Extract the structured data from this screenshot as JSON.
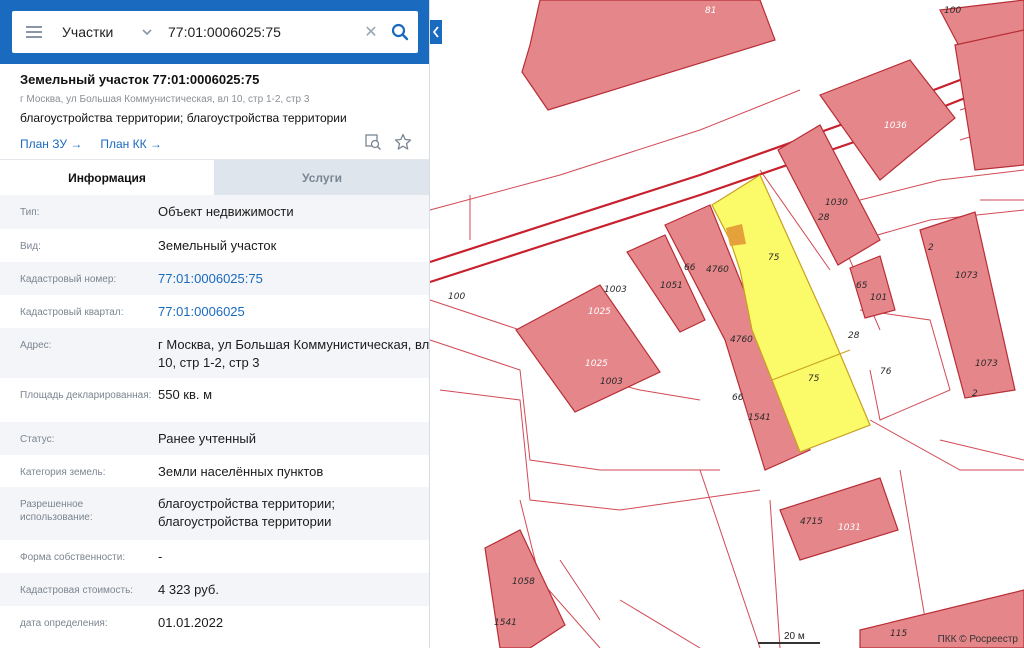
{
  "search": {
    "type_label": "Участки",
    "value": "77:01:0006025:75",
    "placeholder": ""
  },
  "object": {
    "title": "Земельный участок 77:01:0006025:75",
    "address": "г Москва, ул Большая Коммунистическая, вл 10, стр 1-2, стр 3",
    "use": "благоустройства территории; благоустройства территории",
    "links": [
      "План ЗУ →",
      "План КК →"
    ]
  },
  "tabs": [
    "Информация",
    "Услуги"
  ],
  "properties": [
    {
      "key": "Тип:",
      "value": "Объект недвижимости"
    },
    {
      "key": "Вид:",
      "value": "Земельный участок"
    },
    {
      "key": "Кадастровый номер:",
      "value": "77:01:0006025:75",
      "link": true
    },
    {
      "key": "Кадастровый квартал:",
      "value": "77:01:0006025",
      "link": true
    },
    {
      "key": "Адрес:",
      "value": "г Москва, ул Большая Коммунистическая, вл 10, стр 1-2, стр 3"
    },
    {
      "key": "Площадь декларированная:",
      "value": "550 кв. м"
    },
    {
      "key": "Статус:",
      "value": "Ранее учтенный"
    },
    {
      "key": "Категория земель:",
      "value": "Земли населённых пунктов"
    },
    {
      "key": "Разрешенное использование:",
      "value": "благоустройства территории; благоустройства территории"
    },
    {
      "key": "Форма собственности:",
      "value": "-"
    },
    {
      "key": "Кадастровая стоимость:",
      "value": "4 323 руб."
    },
    {
      "key": "дата определения:",
      "value": "01.01.2022"
    }
  ],
  "map": {
    "labels": {
      "l81": "81",
      "l100a": "100",
      "l1036": "1036",
      "l1030": "1030",
      "l28a": "28",
      "l2a": "2",
      "l1073a": "1073",
      "l1073b": "1073",
      "l2b": "2",
      "l75a": "75",
      "l75b": "75",
      "l76": "76",
      "l4760a": "4760",
      "l4760b": "4760",
      "l66a": "66",
      "l66b": "66",
      "l1051": "1051",
      "l1003a": "1003",
      "l1003b": "1003",
      "l1025a": "1025",
      "l1025b": "1025",
      "l100b": "100",
      "l65": "65",
      "l101": "101",
      "l28b": "28",
      "l1541": "1541",
      "l4715": "4715",
      "l1031": "1031",
      "l1058": "1058",
      "l1541b": "1541",
      "l115": "115"
    },
    "scale": "20 м",
    "copyright": "ПКК © Росреестр",
    "colors": {
      "building": "#e5878a",
      "building_stroke": "#b82d36",
      "parcel": "#fbfb6a",
      "road": "#c8202d",
      "panel_header": "#1a6ac0"
    }
  }
}
